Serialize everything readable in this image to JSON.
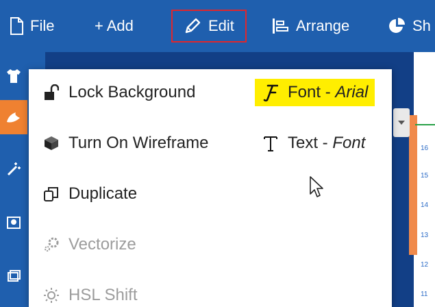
{
  "toolbar": {
    "file": "File",
    "add": "+ Add",
    "edit": "Edit",
    "arrange": "Arrange",
    "shape": "Sh"
  },
  "menu": {
    "lock_background": "Lock Background",
    "wireframe": "Turn On Wireframe",
    "duplicate": "Duplicate",
    "vectorize": "Vectorize",
    "hsl_shift": "HSL Shift",
    "font_label": "Font - ",
    "font_value": "Arial",
    "text_label": "Text - ",
    "text_value": "Font"
  },
  "ruler": {
    "ticks": [
      "16",
      "15",
      "14",
      "13",
      "12",
      "11"
    ]
  },
  "colors": {
    "toolbar_bg": "#1f5fae",
    "highlight": "#ffee00",
    "active_outline": "#e0262c",
    "accent_orange": "#ef8131"
  },
  "icons": {
    "file": "file-icon",
    "edit": "pencil-icon",
    "arrange": "arrange-icon",
    "shape": "pie-icon",
    "lock": "unlock-icon",
    "wireframe": "cube-icon",
    "duplicate": "duplicate-icon",
    "vectorize": "gears-icon",
    "hsl": "sun-icon",
    "font": "font-icon",
    "text": "text-icon"
  }
}
